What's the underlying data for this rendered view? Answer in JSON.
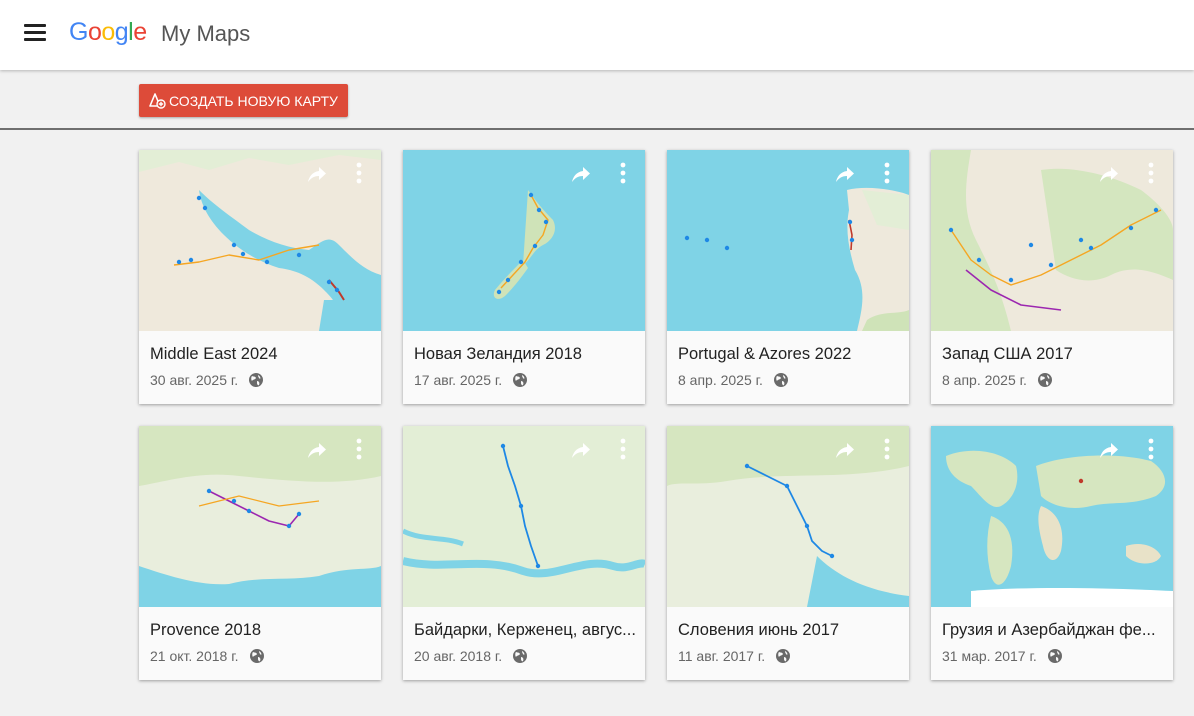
{
  "header": {
    "logo_letters": [
      "G",
      "o",
      "o",
      "g",
      "l",
      "e"
    ],
    "product": "My Maps",
    "menu_icon": "hamburger-menu-icon"
  },
  "toolbar": {
    "create_label": "СОЗДАТЬ НОВУЮ КАРТУ",
    "create_icon": "add-map-icon",
    "create_color": "#dd4b39"
  },
  "maps": [
    {
      "title": "Middle East 2024",
      "date": "30 авг. 2025 г.",
      "visibility_icon": "globe-icon",
      "thumb": "middle-east"
    },
    {
      "title": "Новая Зеландия 2018",
      "date": "17 авг. 2025 г.",
      "visibility_icon": "globe-icon",
      "thumb": "new-zealand"
    },
    {
      "title": "Portugal & Azores 2022",
      "date": "8 апр. 2025 г.",
      "visibility_icon": "globe-icon",
      "thumb": "portugal"
    },
    {
      "title": "Запад США 2017",
      "date": "8 апр. 2025 г.",
      "visibility_icon": "globe-icon",
      "thumb": "usa-west"
    },
    {
      "title": "Provence 2018",
      "date": "21 окт. 2018 г.",
      "visibility_icon": "globe-icon",
      "thumb": "provence"
    },
    {
      "title": "Байдарки, Керженец, авгус...",
      "date": "20 авг. 2018 г.",
      "visibility_icon": "globe-icon",
      "thumb": "kerzhenets"
    },
    {
      "title": "Словения июнь 2017",
      "date": "11 авг. 2017 г.",
      "visibility_icon": "globe-icon",
      "thumb": "slovenia"
    },
    {
      "title": "Грузия и Азербайджан фе...",
      "date": "31 мар. 2017 г.",
      "visibility_icon": "globe-icon",
      "thumb": "world"
    }
  ],
  "colors": {
    "water": "#7fd3e6",
    "land": "#eeebe2",
    "green_land": "#cfe3b8",
    "route_purple": "#9c27b0",
    "route_orange": "#f5a623",
    "marker_blue": "#1e88e5"
  }
}
